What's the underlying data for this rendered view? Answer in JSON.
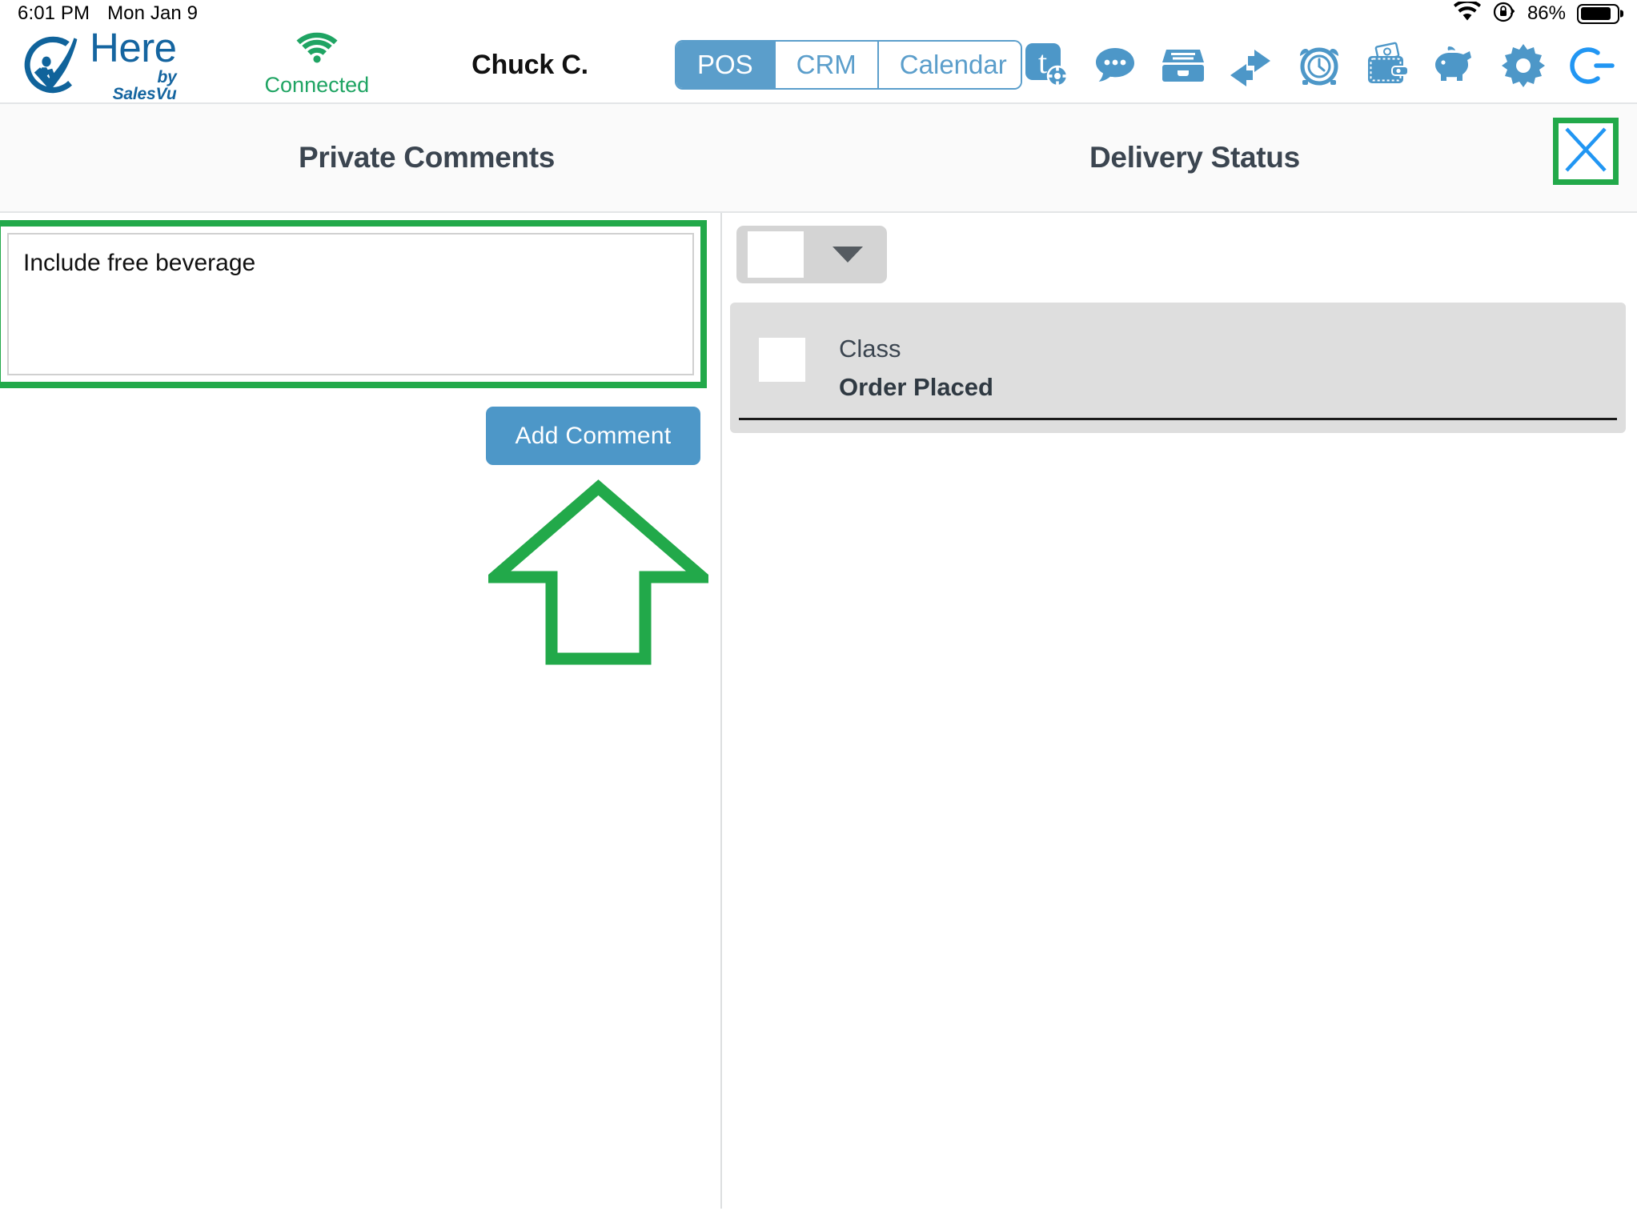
{
  "status_bar": {
    "time": "6:01 PM",
    "date": "Mon Jan 9",
    "wifi_icon": "wifi-icon",
    "orientation_lock_icon": "rotation-lock-icon",
    "battery_percent": "86%",
    "battery_level": 86
  },
  "header": {
    "logo": {
      "icon": "here-checkmark-logo-icon",
      "word": "Here",
      "tagline": "by SalesVu",
      "color": "#1565a0"
    },
    "connection": {
      "icon": "wifi-connected-icon",
      "label": "Connected",
      "color": "#1fa463"
    },
    "user": "Chuck C.",
    "nav_tabs": [
      {
        "label": "POS",
        "active": true
      },
      {
        "label": "CRM",
        "active": false
      },
      {
        "label": "Calendar",
        "active": false
      }
    ],
    "accent_color": "#5b9ecb",
    "toolbar_icons": [
      {
        "name": "tickets-settings-icon",
        "title": "Tickets"
      },
      {
        "name": "chat-bubble-icon",
        "title": "Messages"
      },
      {
        "name": "file-drawer-icon",
        "title": "Orders"
      },
      {
        "name": "transfer-arrows-icon",
        "title": "Transfer"
      },
      {
        "name": "alarm-clock-icon",
        "title": "Time Clock"
      },
      {
        "name": "wallet-cash-icon",
        "title": "Cash Drawer"
      },
      {
        "name": "piggy-bank-icon",
        "title": "Tips"
      },
      {
        "name": "gear-icon",
        "title": "Settings"
      },
      {
        "name": "logout-icon",
        "title": "Log Out"
      }
    ]
  },
  "panels": {
    "left_title": "Private Comments",
    "right_title": "Delivery Status",
    "close_icon": "close-x-icon",
    "close_icon_color": "#2196f3"
  },
  "comments": {
    "textarea_value": "Include free beverage",
    "textarea_placeholder": "",
    "add_button": "Add Comment",
    "add_button_color": "#4d97c8"
  },
  "delivery": {
    "status_dropdown": {
      "selected": "",
      "caret_icon": "chevron-down-icon"
    },
    "card": {
      "swatch_color": "#ffffff",
      "line1": "Class",
      "line2": "Order Placed"
    }
  },
  "annotations": {
    "highlight_color": "#22a94a",
    "arrow_icon": "up-arrow-annotation-icon",
    "boxes": [
      "comment-textarea-highlight",
      "close-button-highlight"
    ]
  }
}
